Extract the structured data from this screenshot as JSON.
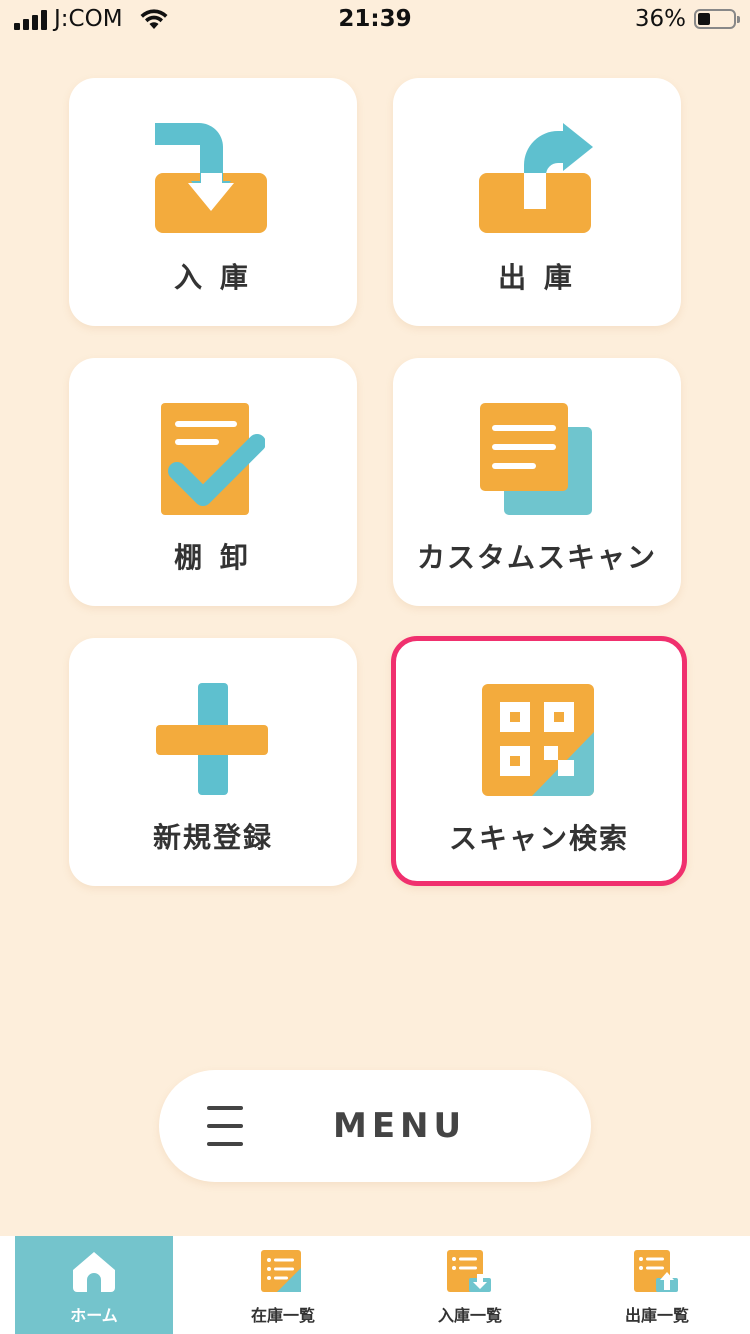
{
  "status_bar": {
    "carrier": "J:COM",
    "time": "21:39",
    "battery_percent": "36%",
    "battery_level": 0.36
  },
  "tiles": [
    {
      "label": "入 庫",
      "icon": "inbound-box-icon"
    },
    {
      "label": "出 庫",
      "icon": "outbound-box-icon"
    },
    {
      "label": "棚 卸",
      "icon": "inventory-check-icon"
    },
    {
      "label": "カスタムスキャン",
      "icon": "documents-stack-icon"
    },
    {
      "label": "新規登録",
      "icon": "plus-icon"
    },
    {
      "label": "スキャン検索",
      "icon": "qr-code-icon"
    }
  ],
  "selected_tile": "スキャン検索",
  "menu": {
    "label": "MENU",
    "icon": "hamburger-icon"
  },
  "tab_bar": [
    {
      "label": "ホーム",
      "icon": "home-icon",
      "active": true
    },
    {
      "label": "在庫一覧",
      "icon": "stock-list-icon",
      "active": false
    },
    {
      "label": "入庫一覧",
      "icon": "inbound-list-icon",
      "active": false
    },
    {
      "label": "出庫一覧",
      "icon": "outbound-list-icon",
      "active": false
    }
  ],
  "colors": {
    "background": "#FDEEDB",
    "orange": "#F3AB3D",
    "teal": "#5EC0CF",
    "highlight": "#F0306E",
    "tab_active": "#74C4CC"
  }
}
